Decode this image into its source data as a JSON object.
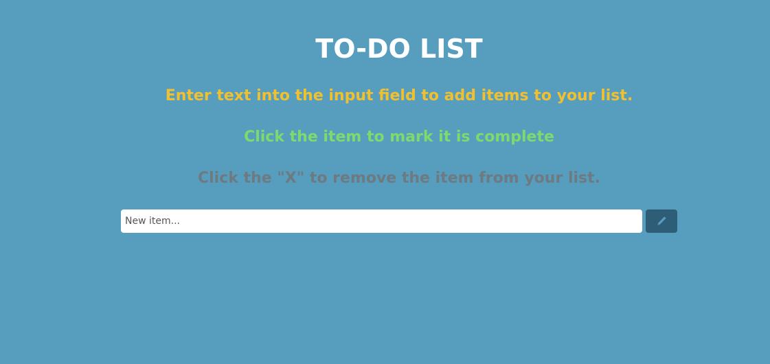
{
  "header": {
    "title": "TO-DO LIST"
  },
  "instructions": {
    "add": "Enter text into the input field to add items to your list.",
    "complete": "Click the item to mark it is complete",
    "remove": "Click the \"X\" to remove the item from your list."
  },
  "form": {
    "input_value": "",
    "input_placeholder": "New item...",
    "add_button_icon": "pencil-icon"
  },
  "colors": {
    "background": "#579dbe",
    "title": "#ffffff",
    "instruction_add": "#f0c030",
    "instruction_complete": "#7ed96f",
    "instruction_remove": "#6e7a82",
    "button_bg": "#2e5e77",
    "button_icon": "#579dbe"
  }
}
